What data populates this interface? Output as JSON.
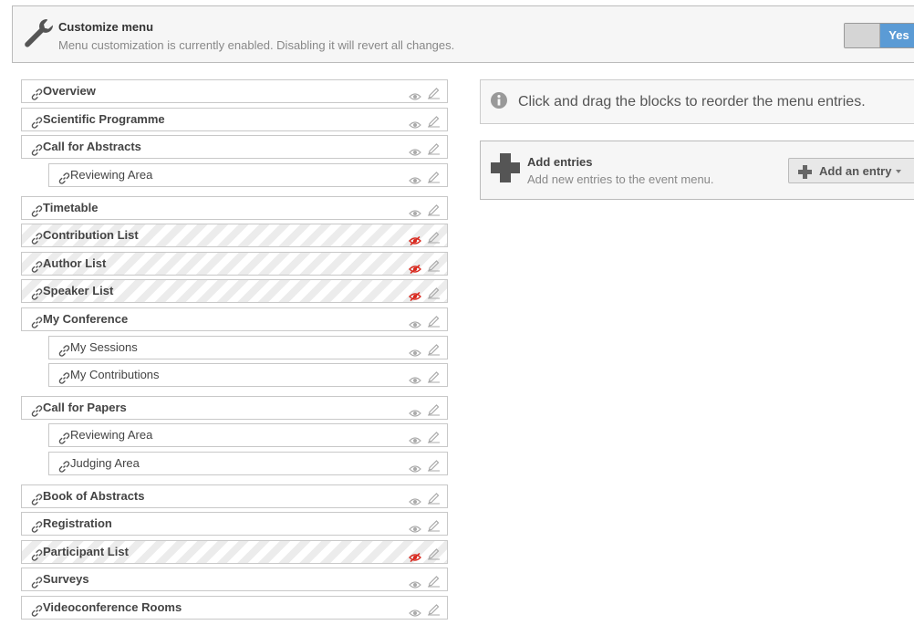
{
  "settings": {
    "title": "Customize menu",
    "description": "Menu customization is currently enabled. Disabling it will revert all changes.",
    "toggle_label": "Yes"
  },
  "menu": [
    {
      "label": "Overview",
      "level": 0,
      "visible": true
    },
    {
      "label": "Scientific Programme",
      "level": 0,
      "visible": true
    },
    {
      "label": "Call for Abstracts",
      "level": 0,
      "visible": true
    },
    {
      "label": "Reviewing Area",
      "level": 1,
      "visible": true
    },
    {
      "label": "Timetable",
      "level": 0,
      "visible": true
    },
    {
      "label": "Contribution List",
      "level": 0,
      "visible": false
    },
    {
      "label": "Author List",
      "level": 0,
      "visible": false
    },
    {
      "label": "Speaker List",
      "level": 0,
      "visible": false
    },
    {
      "label": "My Conference",
      "level": 0,
      "visible": true
    },
    {
      "label": "My Sessions",
      "level": 1,
      "visible": true
    },
    {
      "label": "My Contributions",
      "level": 1,
      "visible": true
    },
    {
      "label": "Call for Papers",
      "level": 0,
      "visible": true
    },
    {
      "label": "Reviewing Area",
      "level": 1,
      "visible": true
    },
    {
      "label": "Judging Area",
      "level": 1,
      "visible": true
    },
    {
      "label": "Book of Abstracts",
      "level": 0,
      "visible": true
    },
    {
      "label": "Registration",
      "level": 0,
      "visible": true
    },
    {
      "label": "Participant List",
      "level": 0,
      "visible": false
    },
    {
      "label": "Surveys",
      "level": 0,
      "visible": true
    },
    {
      "label": "Videoconference Rooms",
      "level": 0,
      "visible": true
    }
  ],
  "info": {
    "text": "Click and drag the blocks to reorder the menu entries."
  },
  "add_entries": {
    "title": "Add entries",
    "description": "Add new entries to the event menu.",
    "button_label": "Add an entry"
  },
  "colors": {
    "accent": "#5b9bd5",
    "hidden_icon": "#d9261c",
    "icon_gray": "#aaaaaa"
  },
  "icons": {
    "settings": "wrench-icon",
    "entry_link": "link-icon",
    "visibility": "eye-icon",
    "hidden": "eye-slash-icon",
    "edit": "edit-icon",
    "info": "info-icon",
    "add": "plus-icon",
    "dropdown": "caret-down-icon"
  }
}
